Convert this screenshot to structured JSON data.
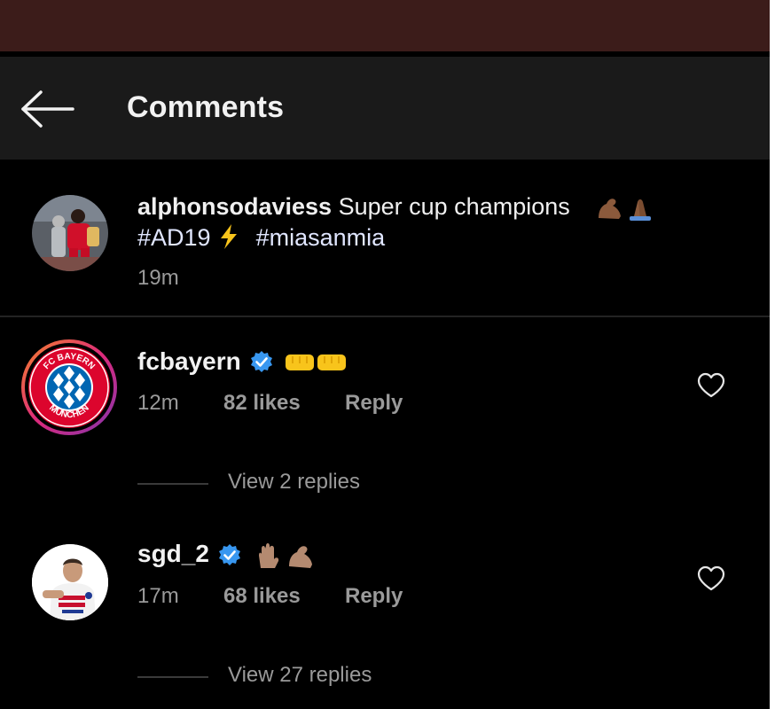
{
  "header": {
    "title": "Comments",
    "back_icon": "arrow-left-icon"
  },
  "caption": {
    "username": "alphonsodaviess",
    "text": "Super cup champions",
    "emojis": [
      "flexed-biceps-medium-dark",
      "folded-hands-medium-dark"
    ],
    "hashtag_1": "#AD19",
    "hashtag_1_emoji": "high-voltage",
    "hashtag_2": "#miasanmia",
    "time": "19m"
  },
  "comments": [
    {
      "username": "fcbayern",
      "verified": true,
      "emojis": [
        "left-facing-fist",
        "right-facing-fist"
      ],
      "time": "12m",
      "likes": "82 likes",
      "reply": "Reply",
      "view_replies": "View 2 replies",
      "like_icon": "heart-outline-icon"
    },
    {
      "username": "sgd_2",
      "verified": true,
      "emojis": [
        "waving-hand-medium",
        "flexed-biceps-medium"
      ],
      "time": "17m",
      "likes": "68 likes",
      "reply": "Reply",
      "view_replies": "View 27 replies",
      "like_icon": "heart-outline-icon"
    }
  ],
  "colors": {
    "status_bar": "#3c1c1a",
    "header_bg": "#1a1a1a",
    "background": "#000000",
    "verified": "#3897f0",
    "bayern_red": "#dc052d",
    "bayern_blue": "#0066b2",
    "story_ring_start": "#f58529",
    "story_ring_end": "#dd2a7b"
  }
}
